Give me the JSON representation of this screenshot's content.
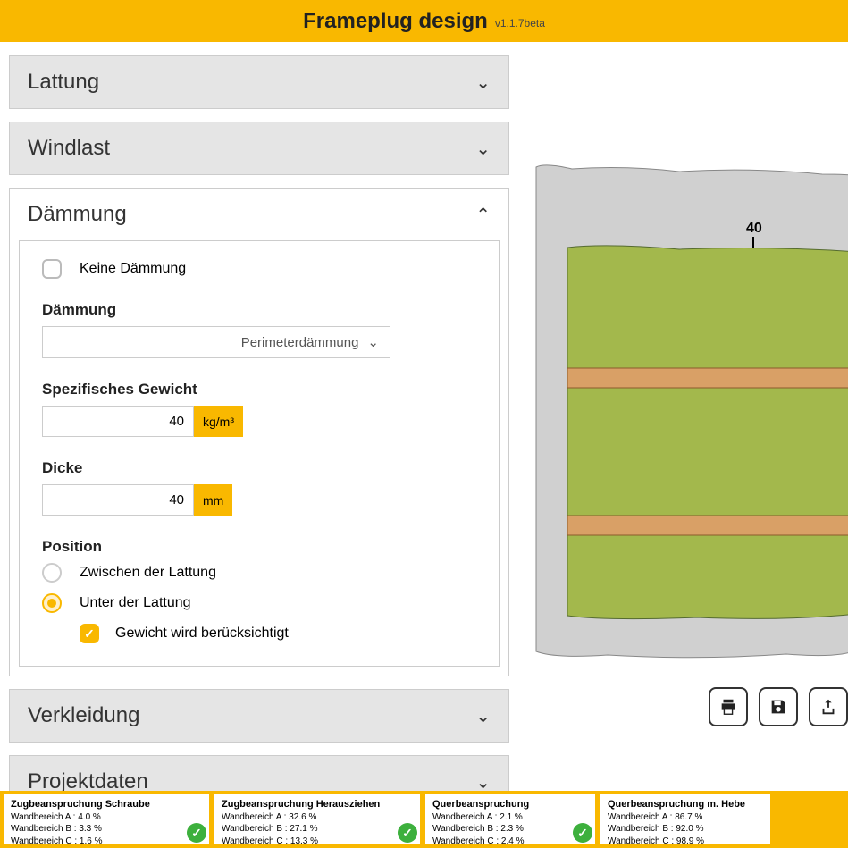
{
  "header": {
    "title": "Frameplug design",
    "version": "v1.1.7beta"
  },
  "accordion": {
    "lattung": "Lattung",
    "windlast": "Windlast",
    "daemmung": "Dämmung",
    "verkleidung": "Verkleidung",
    "projektdaten": "Projektdaten"
  },
  "daemmung": {
    "noInsulation": "Keine Dämmung",
    "typeLabel": "Dämmung",
    "typeValue": "Perimeterdämmung",
    "weightLabel": "Spezifisches Gewicht",
    "weightValue": "40",
    "weightUnit": "kg/m³",
    "thicknessLabel": "Dicke",
    "thicknessValue": "40",
    "thicknessUnit": "mm",
    "positionLabel": "Position",
    "posBetween": "Zwischen der Lattung",
    "posUnder": "Unter der Lattung",
    "weightConsidered": "Gewicht wird berücksichtigt"
  },
  "diagram": {
    "dimension": "40"
  },
  "results": [
    {
      "title": "Zugbeanspruchung Schraube",
      "a": "Wandbereich A : 4.0 %",
      "b": "Wandbereich B : 3.3 %",
      "c": "Wandbereich C : 1.6 %"
    },
    {
      "title": "Zugbeanspruchung Herausziehen",
      "a": "Wandbereich A : 32.6 %",
      "b": "Wandbereich B : 27.1 %",
      "c": "Wandbereich C : 13.3 %"
    },
    {
      "title": "Querbeanspruchung",
      "a": "Wandbereich A : 2.1 %",
      "b": "Wandbereich B : 2.3 %",
      "c": "Wandbereich C : 2.4 %"
    },
    {
      "title": "Querbeanspruchung m. Hebe",
      "a": "Wandbereich A : 86.7 %",
      "b": "Wandbereich B : 92.0 %",
      "c": "Wandbereich C : 98.9 %"
    }
  ]
}
